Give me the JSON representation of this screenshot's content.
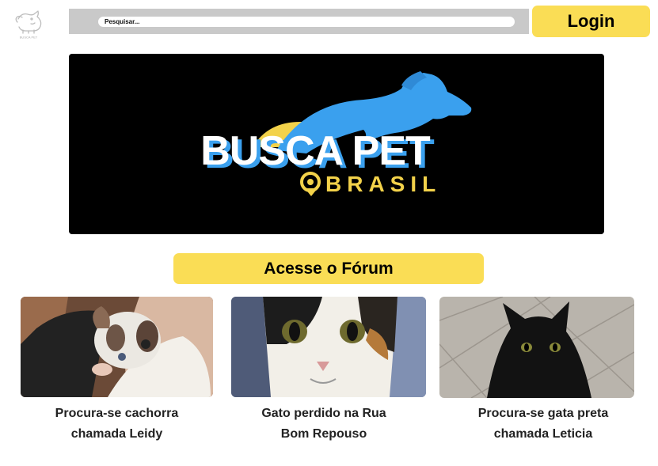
{
  "header": {
    "logo_text": "BUSCA PET",
    "search": {
      "placeholder": "Pesquisar...",
      "value": ""
    },
    "login_label": "Login"
  },
  "banner": {
    "logo_line1": "BUSCA PET",
    "logo_line2": "BRASIL"
  },
  "forum": {
    "label": "Acesse o Fórum"
  },
  "posts": [
    {
      "title_line1": "Procura-se cachorra",
      "title_line2": "chamada Leidy",
      "image": "puppy-photo"
    },
    {
      "title_line1": "Gato perdido na Rua",
      "title_line2": "Bom Repouso",
      "image": "calico-cat-photo"
    },
    {
      "title_line1": "Procura-se gata preta",
      "title_line2": "chamada Leticia",
      "image": "black-cat-photo"
    }
  ],
  "colors": {
    "accent": "#fadd55",
    "banner_bg": "#000000",
    "brand_blue": "#3aa0ee",
    "search_bar": "#c9c9c9"
  }
}
